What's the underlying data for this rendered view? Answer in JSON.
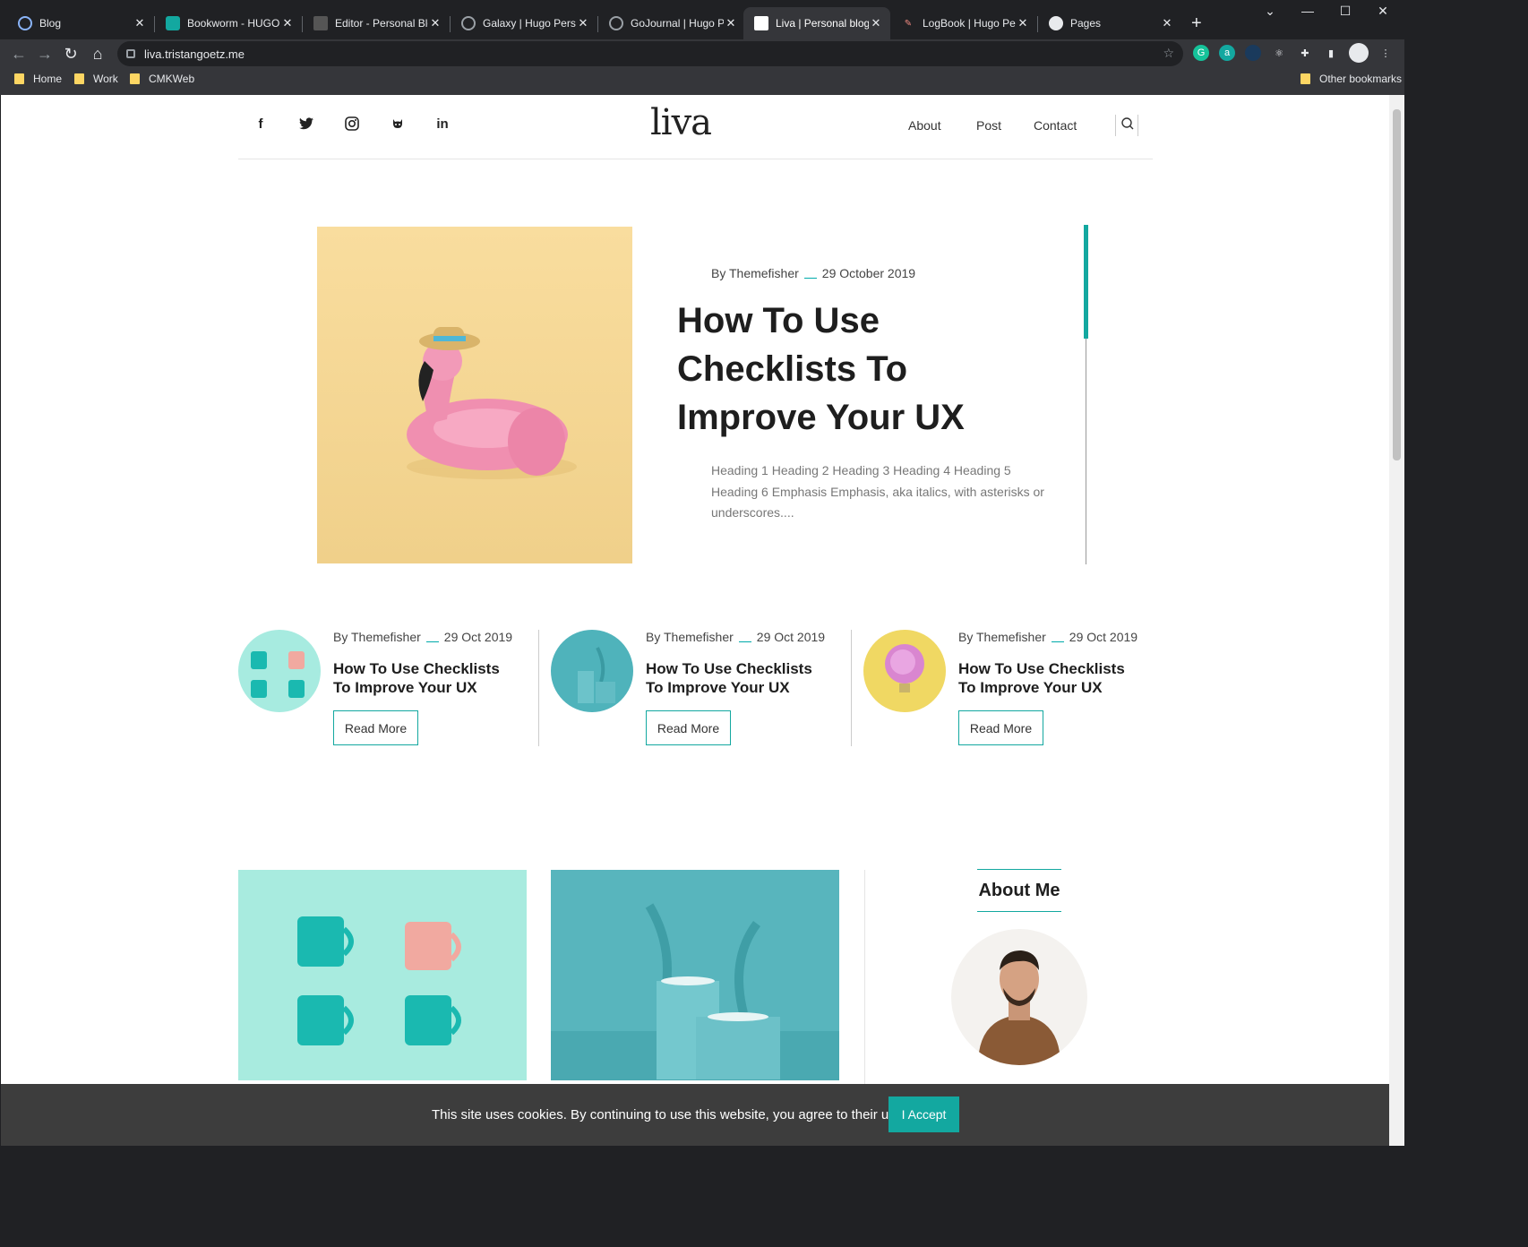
{
  "browser": {
    "tabs": [
      {
        "title": "Blog",
        "active": false
      },
      {
        "title": "Bookworm - HUGO Blog",
        "active": false
      },
      {
        "title": "Editor - Personal Blog",
        "active": false
      },
      {
        "title": "Galaxy | Hugo Personal",
        "active": false
      },
      {
        "title": "GoJournal | Hugo Personal",
        "active": false
      },
      {
        "title": "Liva | Personal blog template",
        "active": true
      },
      {
        "title": "LogBook | Hugo Personal",
        "active": false
      },
      {
        "title": "Pages",
        "active": false
      }
    ],
    "new_tab": "+",
    "url": "liva.tristangoetz.me",
    "bookmarks": [
      "Home",
      "Work",
      "CMKWeb"
    ],
    "other_bookmarks": "Other bookmarks"
  },
  "site": {
    "logo": "liva",
    "social": [
      "f",
      "twitter",
      "instagram",
      "github",
      "in"
    ],
    "nav": [
      "About",
      "Post",
      "Contact"
    ],
    "accent_color": "#13a8a0"
  },
  "hero": {
    "author": "By Themefisher",
    "date": "29 October 2019",
    "title": "How To Use Checklists To Improve Your UX",
    "excerpt": "Heading 1 Heading 2 Heading 3 Heading 4 Heading 5 Heading 6 Emphasis Emphasis, aka italics, with asterisks or underscores...."
  },
  "cards": [
    {
      "author": "By Themefisher",
      "date": "29 Oct 2019",
      "title": "How To Use Checklists To Improve Your UX",
      "button": "Read More"
    },
    {
      "author": "By Themefisher",
      "date": "29 Oct 2019",
      "title": "How To Use Checklists To Improve Your UX",
      "button": "Read More"
    },
    {
      "author": "By Themefisher",
      "date": "29 Oct 2019",
      "title": "How To Use Checklists To Improve Your UX",
      "button": "Read More"
    }
  ],
  "sidebar": {
    "about_title": "About Me"
  },
  "cookie": {
    "message": "This site uses cookies. By continuing to use this website, you agree to their use.",
    "accept": "I Accept"
  }
}
